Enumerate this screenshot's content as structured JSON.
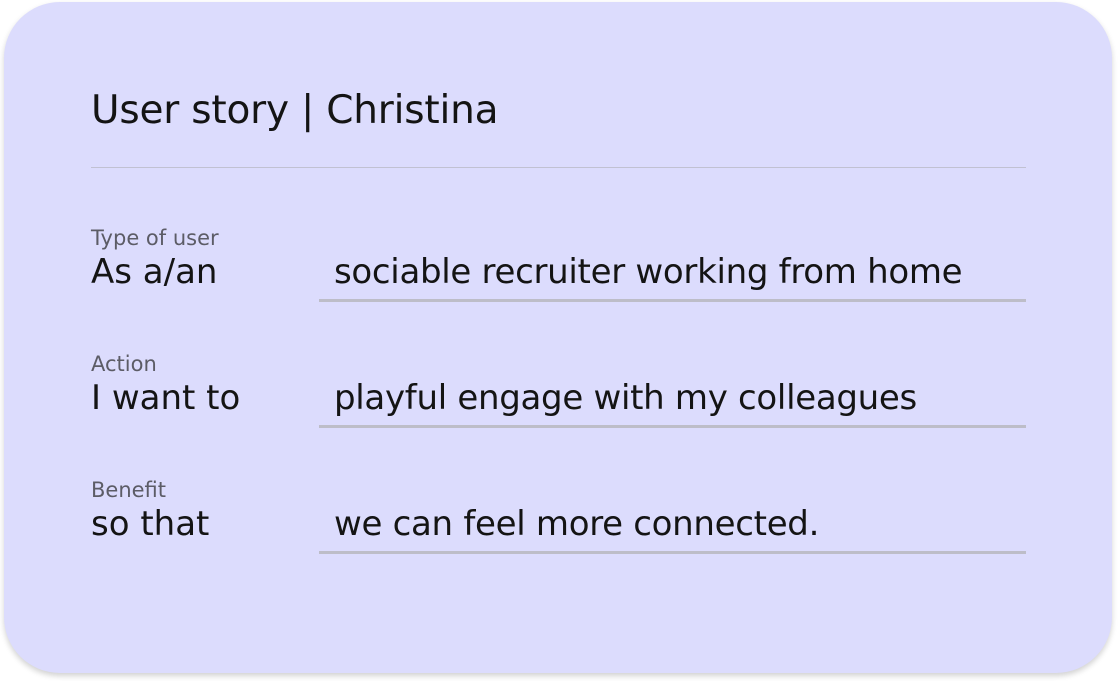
{
  "card": {
    "title": "User story | Christina"
  },
  "rows": [
    {
      "caption": "Type of user",
      "prefix": "As a/an",
      "value": "sociable recruiter working from home"
    },
    {
      "caption": "Action",
      "prefix": "I want to",
      "value": "playful engage with my colleagues"
    },
    {
      "caption": "Benefit",
      "prefix": "so that",
      "value": "we can feel more connected."
    }
  ],
  "colors": {
    "card_background": "#dcdcfd",
    "underline": "#bdbdc8",
    "text": "#141414",
    "caption": "#5c5c66"
  }
}
